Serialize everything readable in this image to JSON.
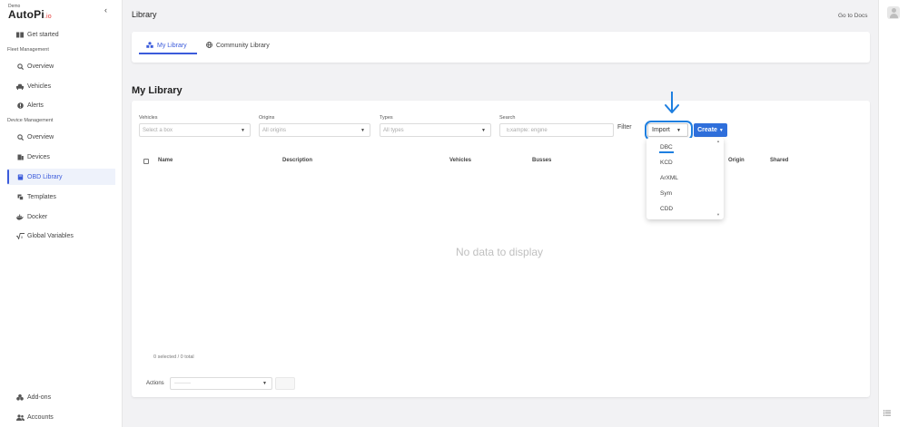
{
  "brand": {
    "demo": "Demo",
    "name": "AutoPi",
    "suffix": ".io"
  },
  "sidebar": {
    "collapse": "‹",
    "items": [
      {
        "label": "Get started",
        "icon": "book-icon"
      },
      {
        "label": "Overview",
        "icon": "search-icon"
      },
      {
        "label": "Vehicles",
        "icon": "car-icon"
      },
      {
        "label": "Alerts",
        "icon": "alert-icon"
      },
      {
        "label": "Overview",
        "icon": "search-icon"
      },
      {
        "label": "Devices",
        "icon": "devices-icon"
      },
      {
        "label": "OBD Library",
        "icon": "library-icon",
        "active": true
      },
      {
        "label": "Templates",
        "icon": "templates-icon"
      },
      {
        "label": "Docker",
        "icon": "docker-icon"
      },
      {
        "label": "Global Variables",
        "icon": "sqrt-icon"
      },
      {
        "label": "Add-ons",
        "icon": "addons-icon"
      },
      {
        "label": "Accounts",
        "icon": "users-icon"
      }
    ],
    "sections": {
      "fleet": "Fleet Management",
      "device": "Device Management"
    }
  },
  "header": {
    "title": "Library",
    "docs_link": "Go to Docs"
  },
  "tabs": [
    {
      "label": "My Library",
      "active": true
    },
    {
      "label": "Community Library",
      "active": false
    }
  ],
  "main": {
    "title": "My Library",
    "filters": {
      "vehicles": {
        "label": "Vehicles",
        "placeholder": "Select a box"
      },
      "origins": {
        "label": "Origins",
        "placeholder": "All origins"
      },
      "types": {
        "label": "Types",
        "placeholder": "All types"
      },
      "search": {
        "label": "Search",
        "placeholder": "Example: engine"
      }
    },
    "filter_button": "Filter",
    "import_button": "Import",
    "create_button": "Create",
    "columns": [
      "Name",
      "Description",
      "Vehicles",
      "Busses",
      "Origin",
      "Shared"
    ],
    "empty_text": "No data to display",
    "selected_count": "0 selected / 0 total",
    "actions_label": "Actions",
    "actions_placeholder": "---------"
  },
  "import_dropdown": {
    "options": [
      "DBC",
      "KCD",
      "ArXML",
      "Sym",
      "CDD"
    ]
  },
  "colors": {
    "accent": "#3b5bdb",
    "create_button": "#2f6fdb",
    "annotation": "#1e7fe0",
    "brand_io": "#e53935"
  }
}
